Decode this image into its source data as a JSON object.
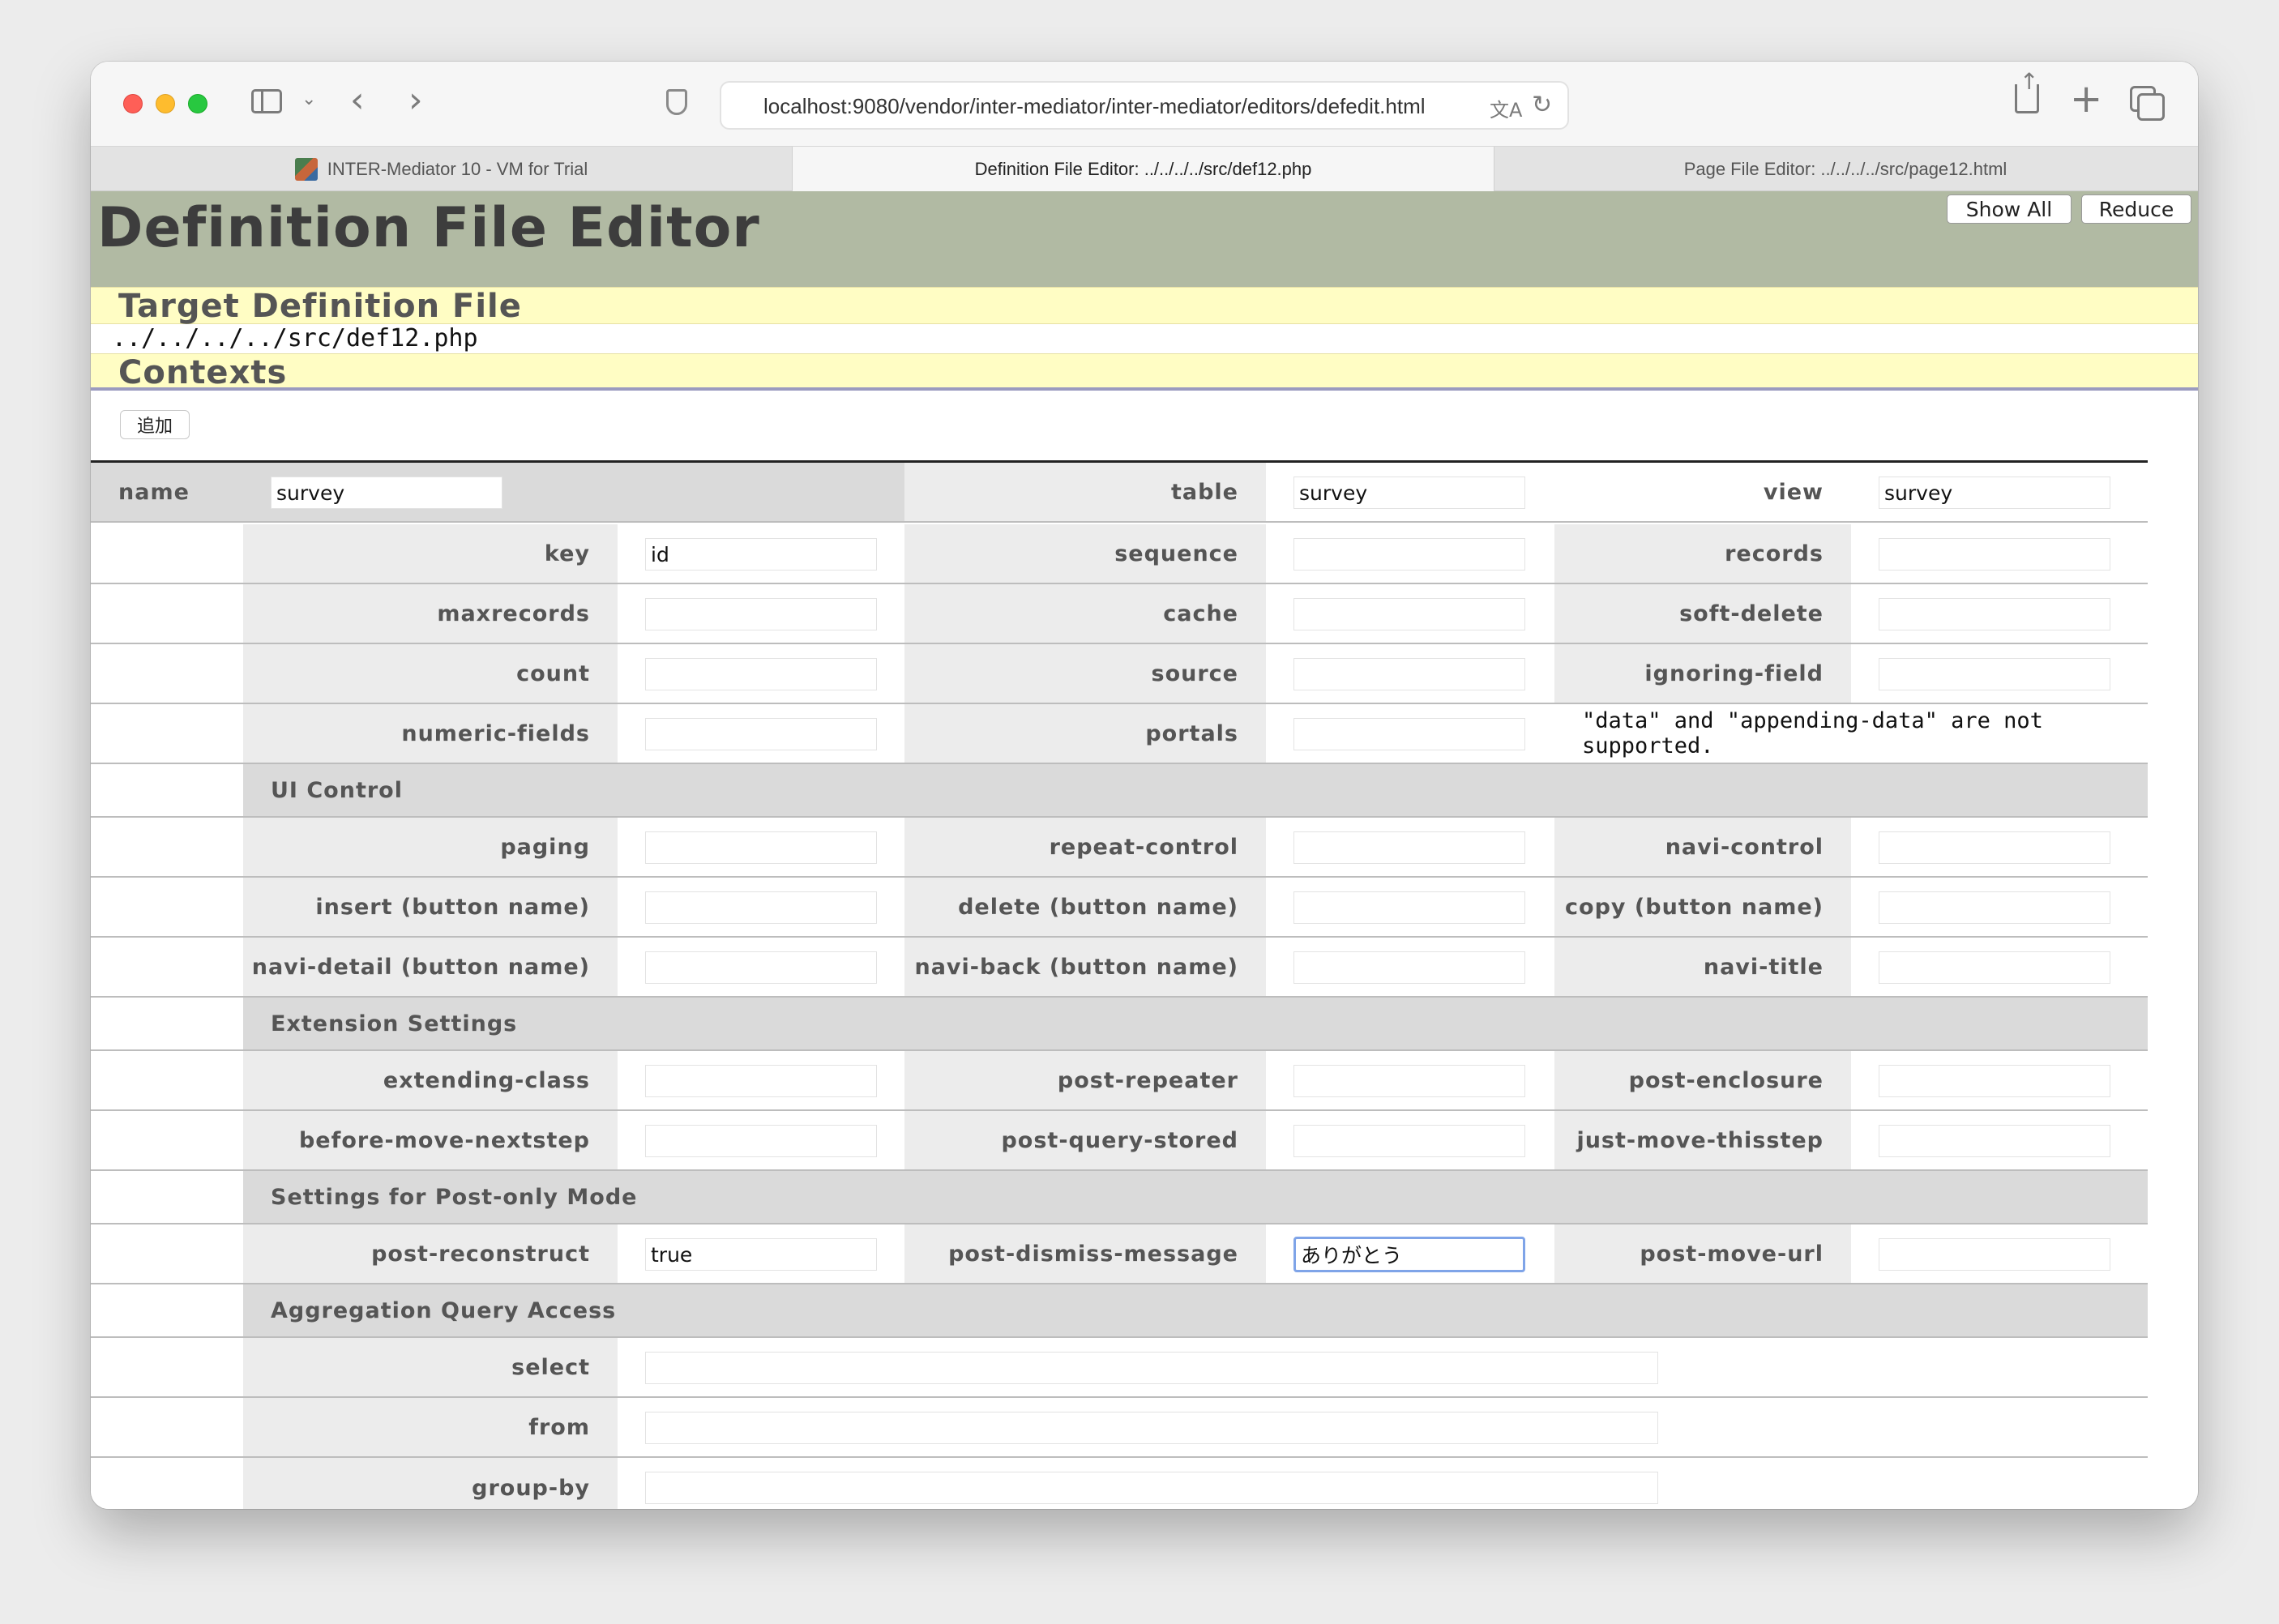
{
  "browser": {
    "address": "localhost:9080/vendor/inter-mediator/inter-mediator/editors/defedit.html",
    "tabs": [
      {
        "label": "INTER-Mediator 10 - VM for Trial"
      },
      {
        "label": "Definition File Editor: ../../../../src/def12.php"
      },
      {
        "label": "Page File Editor: ../../../../src/page12.html"
      }
    ],
    "icons": [
      "sidebar-icon",
      "chevron-down-icon",
      "back-icon",
      "forward-icon",
      "shield-icon",
      "translate-icon",
      "reload-icon",
      "share-icon",
      "plus-icon",
      "tabs-icon"
    ]
  },
  "page": {
    "title": "Definition File Editor",
    "show_all": "Show All",
    "reduce": "Reduce",
    "target_heading": "Target Definition File",
    "target_path": "../../../../src/def12.php",
    "contexts_heading": "Contexts",
    "add_button": "追加"
  },
  "context": {
    "name": {
      "label": "name",
      "value": "survey"
    },
    "table": {
      "label": "table",
      "value": "survey"
    },
    "view": {
      "label": "view",
      "value": "survey"
    },
    "key": {
      "label": "key",
      "value": "id"
    },
    "sequence": {
      "label": "sequence",
      "value": ""
    },
    "records": {
      "label": "records",
      "value": ""
    },
    "maxrecords": {
      "label": "maxrecords",
      "value": ""
    },
    "cache": {
      "label": "cache",
      "value": ""
    },
    "soft_delete": {
      "label": "soft-delete",
      "value": ""
    },
    "count": {
      "label": "count",
      "value": ""
    },
    "source": {
      "label": "source",
      "value": ""
    },
    "ignoring_field": {
      "label": "ignoring-field",
      "value": ""
    },
    "numeric_fields": {
      "label": "numeric-fields",
      "value": ""
    },
    "portals": {
      "label": "portals",
      "value": ""
    },
    "portals_note": "\"data\" and \"appending-data\" are not supported.",
    "ui_control": "UI Control",
    "paging": {
      "label": "paging",
      "value": ""
    },
    "repeat_control": {
      "label": "repeat-control",
      "value": ""
    },
    "navi_control": {
      "label": "navi-control",
      "value": ""
    },
    "insert_button": {
      "label": "insert (button name)",
      "value": ""
    },
    "delete_button": {
      "label": "delete (button name)",
      "value": ""
    },
    "copy_button": {
      "label": "copy (button name)",
      "value": ""
    },
    "navi_detail": {
      "label": "navi-detail (button name)",
      "value": ""
    },
    "navi_back": {
      "label": "navi-back (button name)",
      "value": ""
    },
    "navi_title": {
      "label": "navi-title",
      "value": ""
    },
    "extension_settings": "Extension Settings",
    "extending_class": {
      "label": "extending-class",
      "value": ""
    },
    "post_repeater": {
      "label": "post-repeater",
      "value": ""
    },
    "post_enclosure": {
      "label": "post-enclosure",
      "value": ""
    },
    "before_move_nextstep": {
      "label": "before-move-nextstep",
      "value": ""
    },
    "post_query_stored": {
      "label": "post-query-stored",
      "value": ""
    },
    "just_move_thisstep": {
      "label": "just-move-thisstep",
      "value": ""
    },
    "post_only_mode": "Settings for Post-only Mode",
    "post_reconstruct": {
      "label": "post-reconstruct",
      "value": "true"
    },
    "post_dismiss_message": {
      "label": "post-dismiss-message",
      "value": "ありがとう"
    },
    "post_move_url": {
      "label": "post-move-url",
      "value": ""
    },
    "aggregation": "Aggregation Query Access",
    "select": {
      "label": "select",
      "value": ""
    },
    "from": {
      "label": "from",
      "value": ""
    },
    "group_by": {
      "label": "group-by",
      "value": ""
    }
  }
}
